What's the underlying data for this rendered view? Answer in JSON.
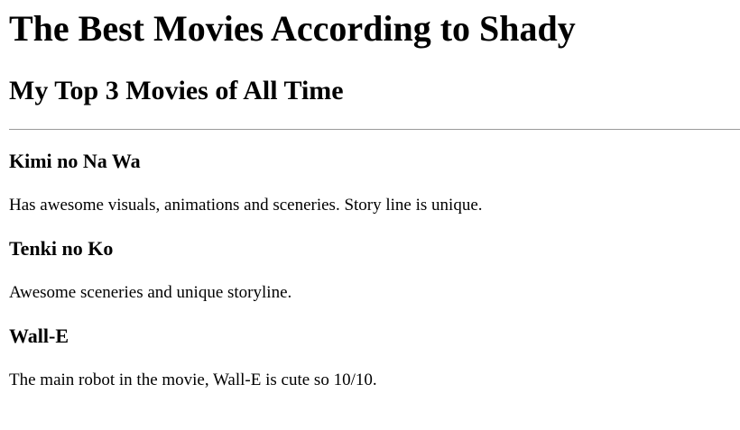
{
  "page": {
    "title": "The Best Movies According to Shady",
    "subtitle": "My Top 3 Movies of All Time"
  },
  "movies": [
    {
      "title": "Kimi no Na Wa",
      "description": "Has awesome visuals, animations and sceneries. Story line is unique."
    },
    {
      "title": "Tenki no Ko",
      "description": "Awesome sceneries and unique storyline."
    },
    {
      "title": "Wall-E",
      "description": "The main robot in the movie, Wall-E is cute so 10/10."
    }
  ]
}
